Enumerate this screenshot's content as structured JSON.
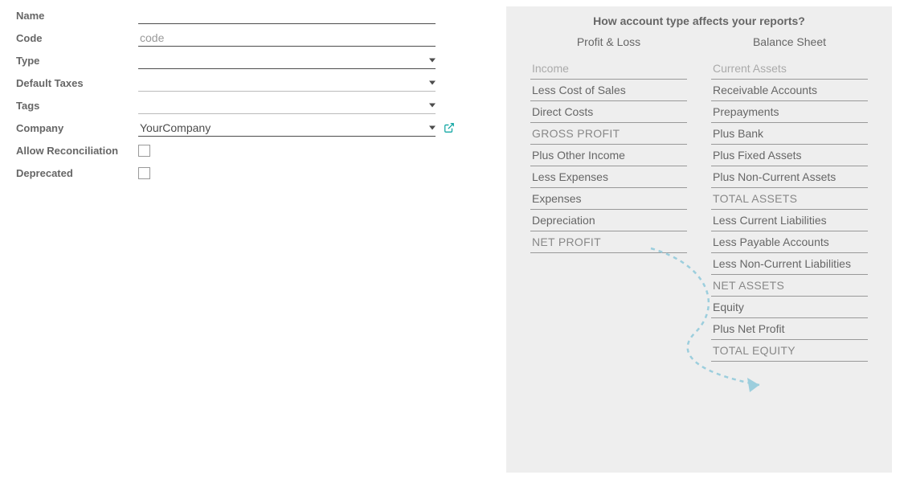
{
  "form": {
    "name": {
      "label": "Name",
      "value": ""
    },
    "code": {
      "label": "Code",
      "value": "",
      "placeholder": "code"
    },
    "type": {
      "label": "Type",
      "value": ""
    },
    "default_taxes": {
      "label": "Default Taxes",
      "value": ""
    },
    "tags": {
      "label": "Tags",
      "value": ""
    },
    "company": {
      "label": "Company",
      "value": "YourCompany"
    },
    "allow_reconciliation": {
      "label": "Allow Reconciliation",
      "checked": false
    },
    "deprecated": {
      "label": "Deprecated",
      "checked": false
    }
  },
  "info": {
    "title": "How account type affects your reports?",
    "pl": {
      "header": "Profit & Loss",
      "lines": [
        {
          "text": "Income",
          "muted": true
        },
        {
          "text": "Less Cost of Sales"
        },
        {
          "text": "Direct Costs"
        },
        {
          "text": "GROSS PROFIT",
          "total": true
        },
        {
          "text": "Plus Other Income"
        },
        {
          "text": "Less Expenses"
        },
        {
          "text": "Expenses"
        },
        {
          "text": "Depreciation"
        },
        {
          "text": "NET PROFIT",
          "total": true
        }
      ]
    },
    "bs": {
      "header": "Balance Sheet",
      "lines": [
        {
          "text": "Current Assets",
          "muted": true
        },
        {
          "text": "Receivable Accounts"
        },
        {
          "text": "Prepayments"
        },
        {
          "text": "Plus Bank"
        },
        {
          "text": "Plus Fixed Assets"
        },
        {
          "text": "Plus Non-Current Assets"
        },
        {
          "text": "TOTAL ASSETS",
          "total": true
        },
        {
          "text": "Less Current Liabilities"
        },
        {
          "text": "Less Payable Accounts"
        },
        {
          "text": "Less Non-Current Liabilities"
        },
        {
          "text": "NET ASSETS",
          "total": true
        },
        {
          "text": "Equity"
        },
        {
          "text": "Plus Net Profit"
        },
        {
          "text": "TOTAL EQUITY",
          "total": true
        }
      ]
    }
  }
}
